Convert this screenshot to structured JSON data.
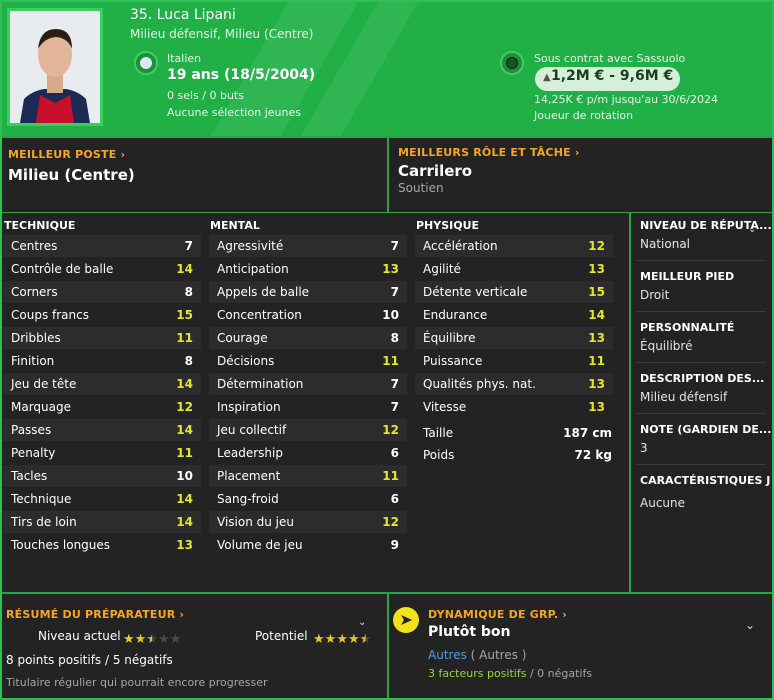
{
  "player": {
    "name": "35. Luca Lipani",
    "role": "Milieu défensif, Milieu (Centre)",
    "nationality": "Italien",
    "age": "19 ans (18/5/2004)",
    "caps": "0 sels / 0 buts",
    "youth_caps": "Aucune sélection jeunes",
    "contract": "Sous contrat avec Sassuolo",
    "value": "1,2M € - 9,6M €",
    "wage": "14,25K € p/m jusqu'au 30/6/2024",
    "squad_status": "Joueur de rotation"
  },
  "best_position": {
    "label": "MEILLEUR POSTE",
    "value": "Milieu (Centre)"
  },
  "best_role": {
    "label": "MEILLEURS RÔLE ET TÂCHE",
    "value": "Carrilero",
    "duty": "Soutien"
  },
  "technical": {
    "title": "TECHNIQUE",
    "attributes": [
      {
        "name": "Centres",
        "value": "7"
      },
      {
        "name": "Contrôle de balle",
        "value": "14"
      },
      {
        "name": "Corners",
        "value": "8"
      },
      {
        "name": "Coups francs",
        "value": "15"
      },
      {
        "name": "Dribbles",
        "value": "11"
      },
      {
        "name": "Finition",
        "value": "8"
      },
      {
        "name": "Jeu de tête",
        "value": "14"
      },
      {
        "name": "Marquage",
        "value": "12"
      },
      {
        "name": "Passes",
        "value": "14"
      },
      {
        "name": "Penalty",
        "value": "11"
      },
      {
        "name": "Tacles",
        "value": "10"
      },
      {
        "name": "Technique",
        "value": "14"
      },
      {
        "name": "Tirs de loin",
        "value": "14"
      },
      {
        "name": "Touches longues",
        "value": "13"
      }
    ]
  },
  "mental": {
    "title": "MENTAL",
    "attributes": [
      {
        "name": "Agressivité",
        "value": "7"
      },
      {
        "name": "Anticipation",
        "value": "13"
      },
      {
        "name": "Appels de balle",
        "value": "7"
      },
      {
        "name": "Concentration",
        "value": "10"
      },
      {
        "name": "Courage",
        "value": "8"
      },
      {
        "name": "Décisions",
        "value": "11"
      },
      {
        "name": "Détermination",
        "value": "7"
      },
      {
        "name": "Inspiration",
        "value": "7"
      },
      {
        "name": "Jeu collectif",
        "value": "12"
      },
      {
        "name": "Leadership",
        "value": "6"
      },
      {
        "name": "Placement",
        "value": "11"
      },
      {
        "name": "Sang-froid",
        "value": "6"
      },
      {
        "name": "Vision du jeu",
        "value": "12"
      },
      {
        "name": "Volume de jeu",
        "value": "9"
      }
    ]
  },
  "physical": {
    "title": "PHYSIQUE",
    "attributes": [
      {
        "name": "Accélération",
        "value": "12"
      },
      {
        "name": "Agilité",
        "value": "13"
      },
      {
        "name": "Détente verticale",
        "value": "15"
      },
      {
        "name": "Endurance",
        "value": "14"
      },
      {
        "name": "Équilibre",
        "value": "13"
      },
      {
        "name": "Puissance",
        "value": "11"
      },
      {
        "name": "Qualités phys. nat.",
        "value": "13"
      },
      {
        "name": "Vitesse",
        "value": "13"
      }
    ],
    "height_label": "Taille",
    "height": "187 cm",
    "weight_label": "Poids",
    "weight": "72 kg"
  },
  "side": {
    "reputation_label": "NIVEAU DE RÉPUTA...",
    "reputation": "National",
    "foot_label": "MEILLEUR PIED",
    "foot": "Droit",
    "personality_label": "PERSONNALITÉ",
    "personality": "Équilibré",
    "media_label": "DESCRIPTION DES...",
    "media": "Milieu défensif",
    "gk_label": "NOTE (GARDIEN DE...",
    "gk": "3",
    "traits_label": "CARACTÉRISTIQUES J",
    "traits": "Aucune"
  },
  "coach": {
    "label": "RÉSUMÉ DU PRÉPARATEUR",
    "current_label": "Niveau actuel",
    "current_stars": 2.5,
    "potential_label": "Potentiel",
    "potential_stars": 4.5,
    "points": "8 points positifs / 5 négatifs",
    "summary": "Titulaire régulier qui pourrait encore progresser"
  },
  "dynamics": {
    "label": "DYNAMIQUE DE GRP.",
    "value": "Plutôt bon",
    "group_link": "Autres",
    "group_paren": "( Autres )",
    "positive": "3 facteurs positifs",
    "negative": "0 négatifs"
  },
  "colors": {
    "accent": "#f5a623",
    "high": "#e5e52c",
    "mid": "#9ad632",
    "header": "#21b046"
  }
}
